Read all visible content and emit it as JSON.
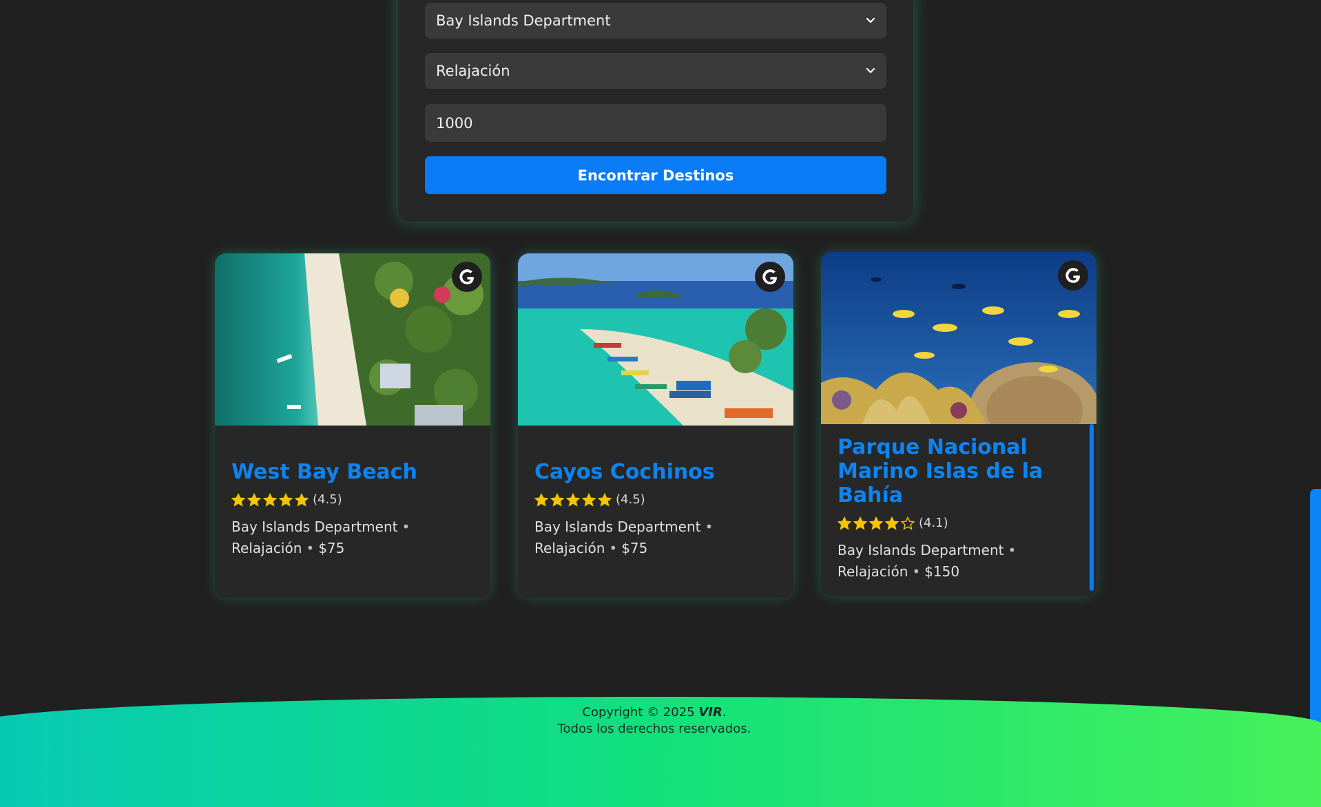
{
  "form": {
    "department_value": "Bay Islands Department",
    "category_value": "Relajación",
    "budget_value": "1000",
    "submit_label": "Encontrar Destinos"
  },
  "cards": [
    {
      "title": "West Bay Beach",
      "rating_text": "(4.5)",
      "rating": 4.5,
      "department": "Bay Islands Department",
      "category": "Relajación",
      "price": "$75",
      "image": "aerial-beach-photo"
    },
    {
      "title": "Cayos Cochinos",
      "rating_text": "(4.5)",
      "rating": 4.5,
      "department": "Bay Islands Department",
      "category": "Relajación",
      "price": "$75",
      "image": "island-boats-photo"
    },
    {
      "title": "Parque Nacional Marino Islas de la Bahía",
      "rating_text": "(4.1)",
      "rating": 4.1,
      "department": "Bay Islands Department",
      "category": "Relajación",
      "price": "$150",
      "image": "coral-reef-photo"
    }
  ],
  "footer": {
    "copyright_prefix": "Copyright © 2025",
    "brand": "VIR",
    "period": ".",
    "rights": "Todos los derechos reservados."
  },
  "colors": {
    "accent": "#0a7cf5",
    "background": "#202020",
    "card": "#272727",
    "star": "#f5c400",
    "footer_gradient": [
      "#08c9b6",
      "#46f15a"
    ]
  },
  "icons": {
    "dropdown": "chevron-down-icon",
    "badge": "google-icon",
    "rating": "star-icon"
  }
}
